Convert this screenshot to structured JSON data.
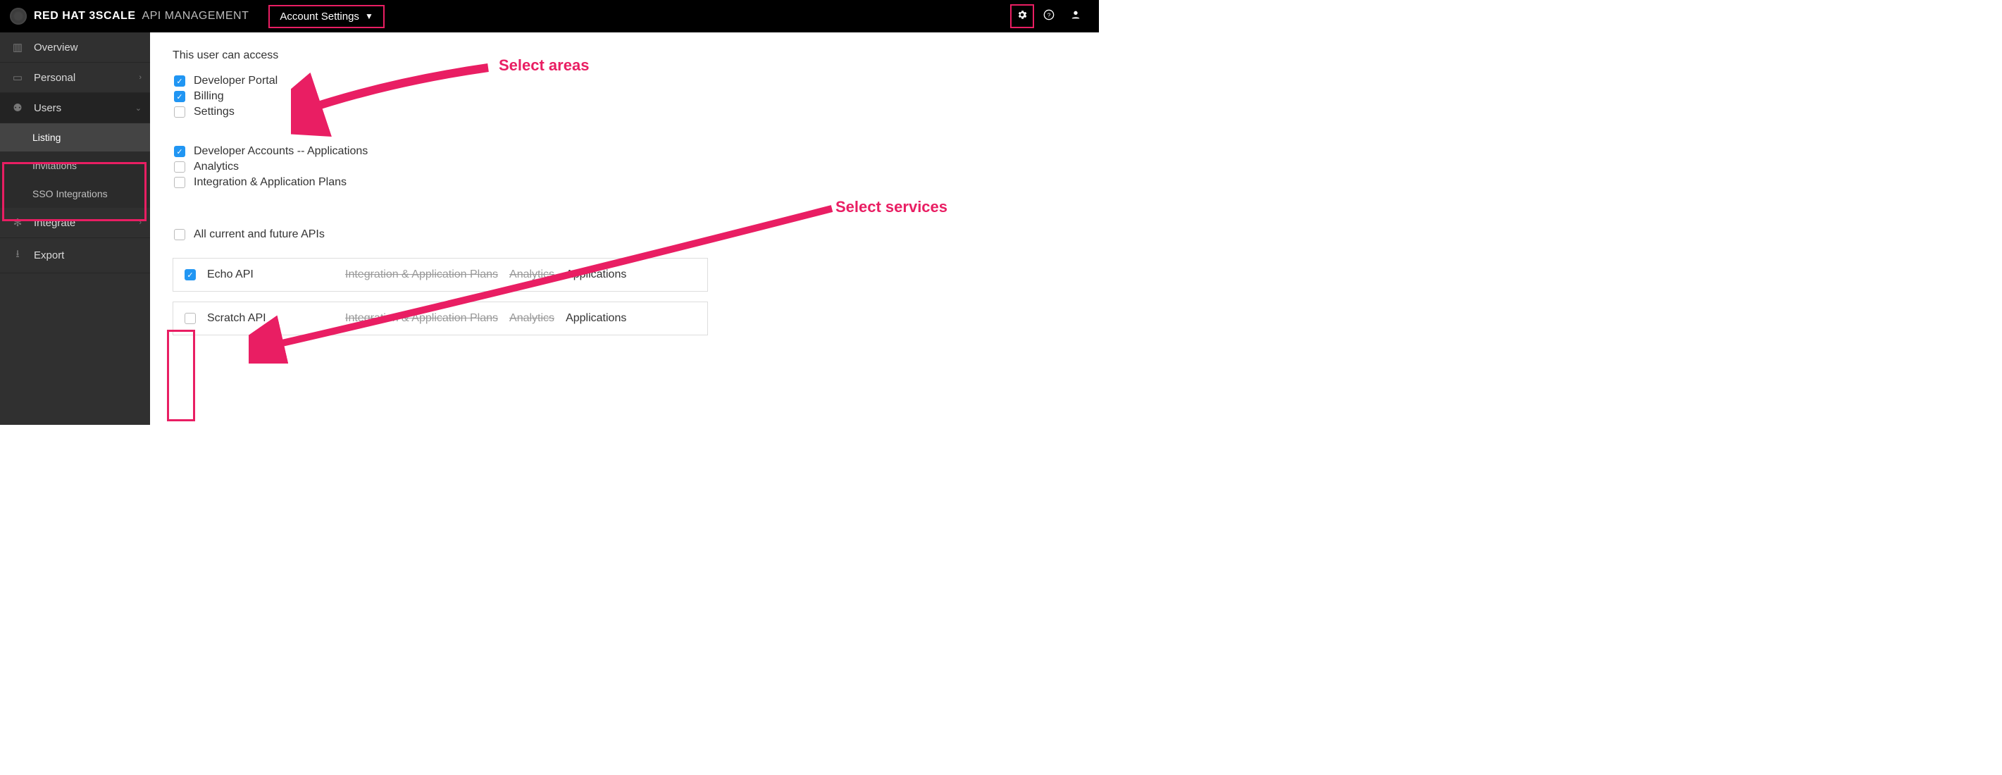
{
  "topbar": {
    "brand_bold1": "RED HAT",
    "brand_bold2": "3SCALE",
    "brand_thin": "API MANAGEMENT",
    "dropdown_label": "Account Settings"
  },
  "sidebar": {
    "overview": "Overview",
    "personal": "Personal",
    "users": "Users",
    "users_children": {
      "listing": "Listing",
      "invitations": "Invitations",
      "sso": "SSO Integrations"
    },
    "integrate": "Integrate",
    "export": "Export"
  },
  "main": {
    "access_heading": "This user can access",
    "areas": {
      "devportal": "Developer Portal",
      "billing": "Billing",
      "settings": "Settings"
    },
    "perms": {
      "devaccounts": "Developer Accounts -- Applications",
      "analytics": "Analytics",
      "int_plans": "Integration & Application Plans"
    },
    "all_apis": "All current and future APIs",
    "api_rows": [
      {
        "name": "Echo API",
        "int": "Integration & Application Plans",
        "analytics": "Analytics",
        "apps": "Applications",
        "checked": true
      },
      {
        "name": "Scratch API",
        "int": "Integration & Application Plans",
        "analytics": "Analytics",
        "apps": "Applications",
        "checked": false
      }
    ]
  },
  "annotations": {
    "select_areas": "Select areas",
    "select_services": "Select services"
  }
}
